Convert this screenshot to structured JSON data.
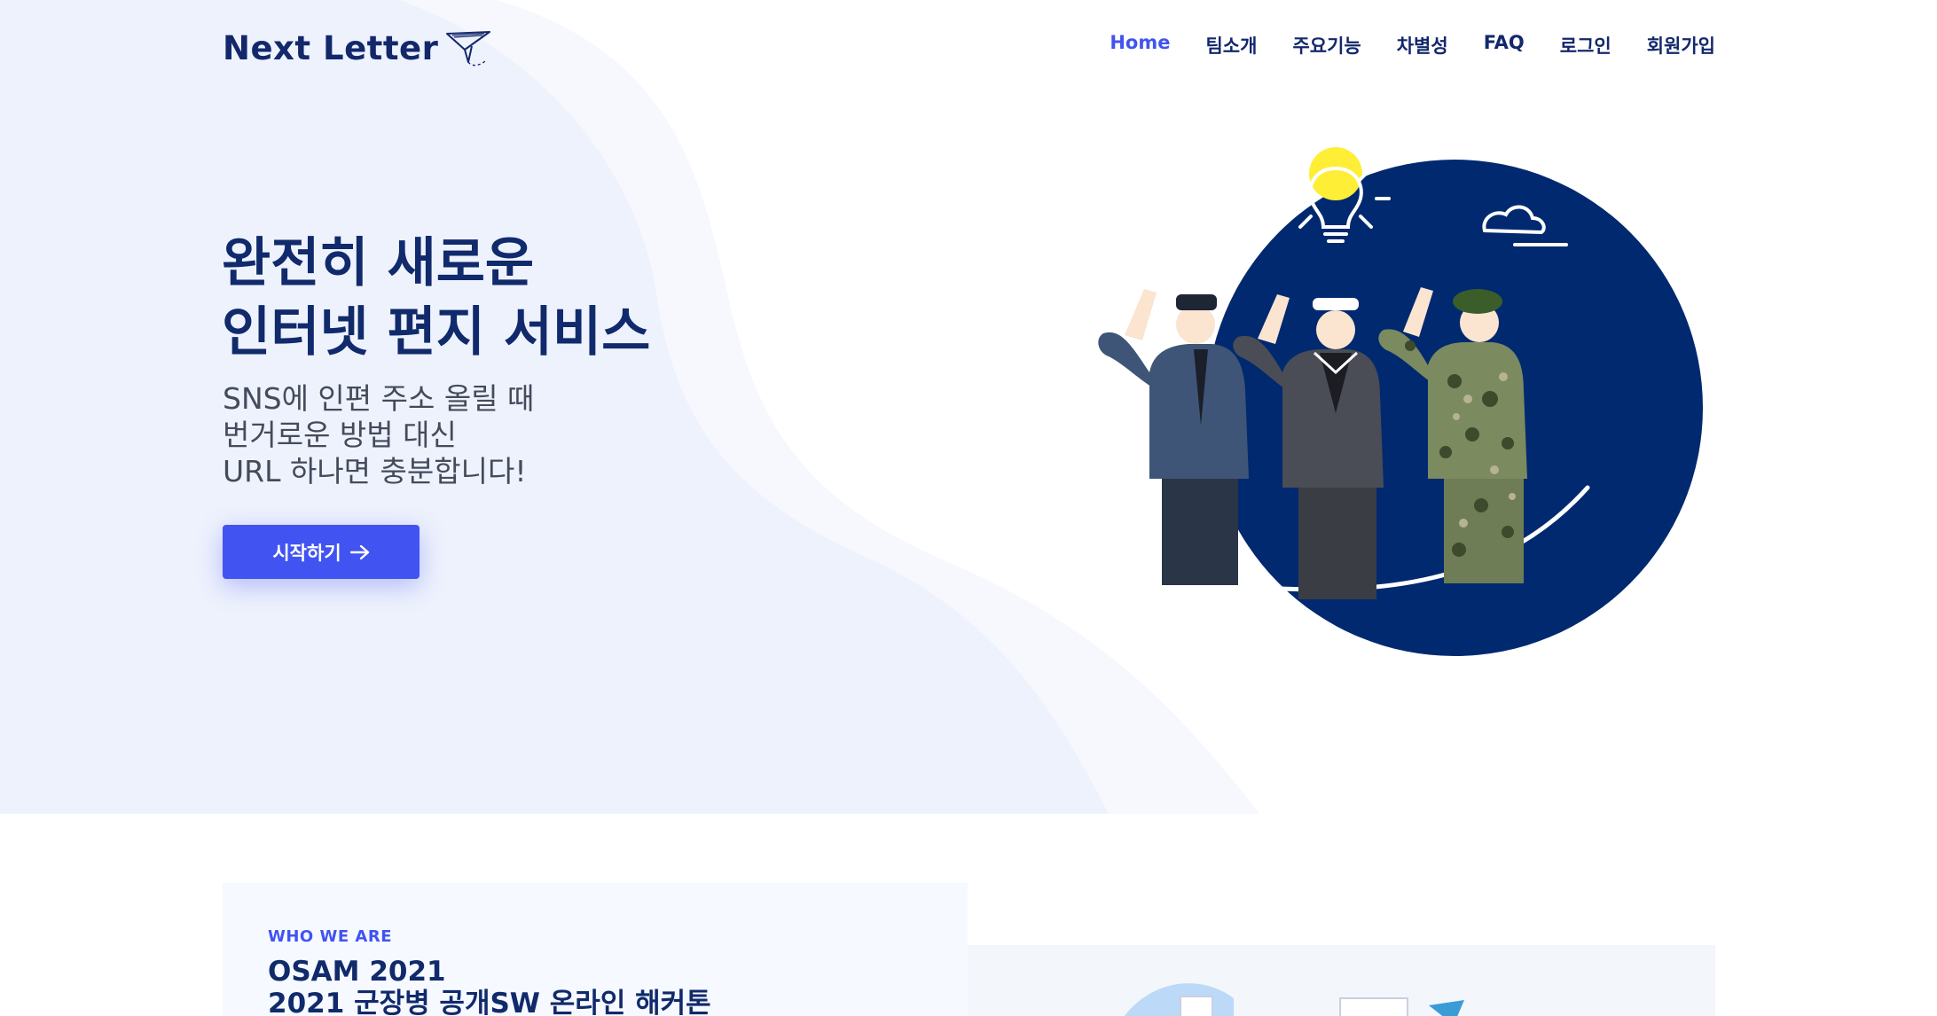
{
  "header": {
    "logo_text": "Next Letter",
    "nav": [
      {
        "label": "Home",
        "active": true
      },
      {
        "label": "팀소개"
      },
      {
        "label": "주요기능"
      },
      {
        "label": "차별성"
      },
      {
        "label": "FAQ"
      },
      {
        "label": "로그인"
      },
      {
        "label": "회원가입"
      }
    ]
  },
  "hero": {
    "title_line1": "완전히 새로운",
    "title_line2": "인터넷 편지 서비스",
    "subtitle_line1": "SNS에 인편 주소 올릴 때",
    "subtitle_line2": "번거로운 방법 대신",
    "subtitle_line3": "URL 하나면 충분합니다!",
    "cta_label": "시작하기",
    "cta_icon": "arrow-right-icon",
    "illustration": "saluting-soldiers-illustration"
  },
  "about": {
    "eyebrow": "WHO WE ARE",
    "title_line1": "OSAM 2021",
    "title_line2": "2021 군장병 공개SW 온라인 해커톤"
  },
  "colors": {
    "primary": "#4154f1",
    "navy": "#012970",
    "heading": "#102a6b",
    "hero_bg": "#f0f3fe",
    "sun": "#ffee36"
  }
}
